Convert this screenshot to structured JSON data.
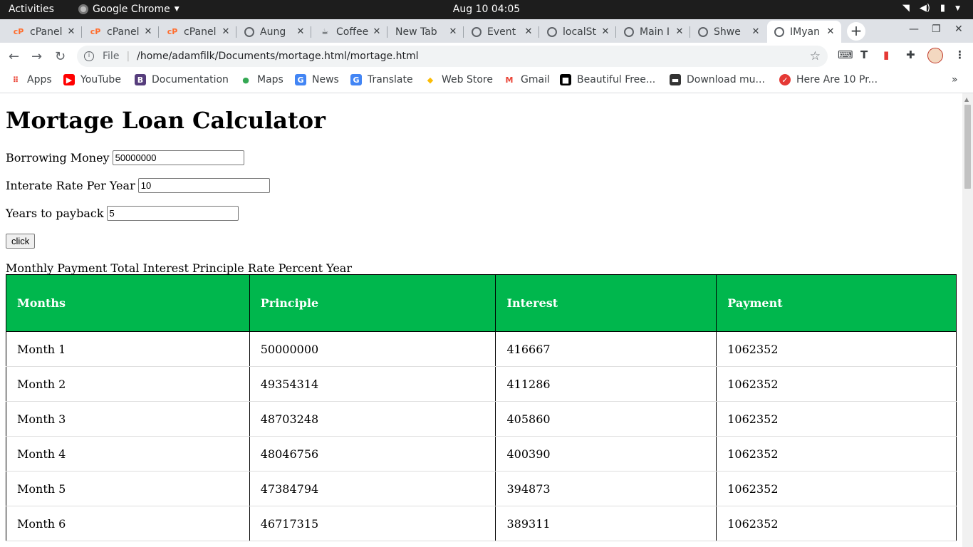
{
  "gnome": {
    "activities": "Activities",
    "app_name": "Google Chrome",
    "clock": "Aug 10  04:05"
  },
  "tabs": [
    {
      "title": "cPanel",
      "icon": "cpanel-icon",
      "active": false
    },
    {
      "title": "cPanel",
      "icon": "cpanel-icon",
      "active": false
    },
    {
      "title": "cPanel",
      "icon": "cpanel-icon",
      "active": false
    },
    {
      "title": "Aung",
      "icon": "globe-icon",
      "active": false
    },
    {
      "title": "Coffee",
      "icon": "coffee-icon",
      "active": false
    },
    {
      "title": "New Tab",
      "icon": "",
      "active": false
    },
    {
      "title": "Event",
      "icon": "globe-icon",
      "active": false
    },
    {
      "title": "localSt",
      "icon": "globe-icon",
      "active": false
    },
    {
      "title": "Main I",
      "icon": "globe-icon",
      "active": false
    },
    {
      "title": "Shwe",
      "icon": "globe-icon",
      "active": false
    },
    {
      "title": "IMyan",
      "icon": "globe-icon",
      "active": true
    }
  ],
  "omnibox": {
    "protocol": "File",
    "url": "/home/adamfilk/Documents/mortage.html/mortage.html"
  },
  "bookmarks": [
    {
      "label": "Apps",
      "icon": "apps-grid-icon",
      "color": "#ea4335"
    },
    {
      "label": "YouTube",
      "icon": "youtube-icon",
      "color": "#ff0000"
    },
    {
      "label": "Documentation",
      "icon": "bootstrap-icon",
      "color": "#563d7c"
    },
    {
      "label": "Maps",
      "icon": "maps-pin-icon",
      "color": "#34a853"
    },
    {
      "label": "News",
      "icon": "news-icon",
      "color": "#4285f4"
    },
    {
      "label": "Translate",
      "icon": "translate-icon",
      "color": "#4285f4"
    },
    {
      "label": "Web Store",
      "icon": "webstore-icon",
      "color": "#fbbc05"
    },
    {
      "label": "Gmail",
      "icon": "gmail-icon",
      "color": "#ea4335"
    },
    {
      "label": "Beautiful Free...",
      "icon": "unsplash-icon",
      "color": "#000000"
    },
    {
      "label": "Download mu...",
      "icon": "download-music-icon",
      "color": "#333333"
    },
    {
      "label": "Here Are 10 Pr...",
      "icon": "article-icon",
      "color": "#e53935"
    }
  ],
  "page": {
    "title": "Mortage Loan Calculator",
    "borrowing_label": "Borrowing Money",
    "borrowing_value": "50000000",
    "rate_label": "Interate Rate Per Year",
    "rate_value": "10",
    "years_label": "Years to payback",
    "years_value": "5",
    "button_label": "click",
    "summary": "Monthly Payment Total Interest Principle Rate Percent Year"
  },
  "table": {
    "headers": [
      "Months",
      "Principle",
      "Interest",
      "Payment"
    ],
    "rows": [
      [
        "Month 1",
        "50000000",
        "416667",
        "1062352"
      ],
      [
        "Month 2",
        "49354314",
        "411286",
        "1062352"
      ],
      [
        "Month 3",
        "48703248",
        "405860",
        "1062352"
      ],
      [
        "Month 4",
        "48046756",
        "400390",
        "1062352"
      ],
      [
        "Month 5",
        "47384794",
        "394873",
        "1062352"
      ],
      [
        "Month 6",
        "46717315",
        "389311",
        "1062352"
      ]
    ]
  },
  "colors": {
    "table_header_bg": "#00b74d",
    "tab_strip_bg": "#dee1e6",
    "top_bar_bg": "#1d1d1d"
  }
}
